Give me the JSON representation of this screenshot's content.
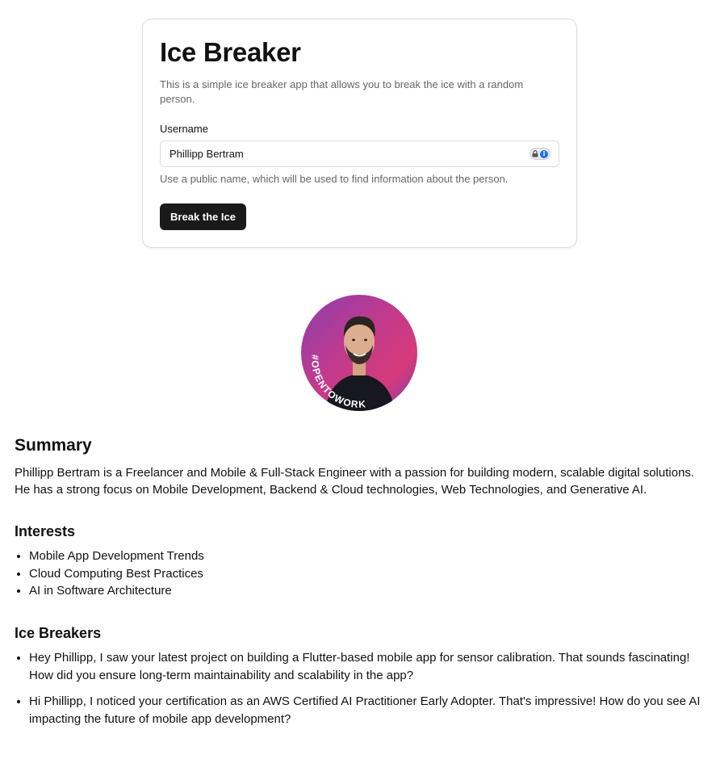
{
  "form": {
    "title": "Ice Breaker",
    "description": "This is a simple ice breaker app that allows you to break the ice with a random person.",
    "username_label": "Username",
    "username_value": "Phillipp Bertram",
    "help_text": "Use a public name, which will be used to find information about the person.",
    "submit_label": "Break the Ice",
    "password_manager_icon": "lock-info-icon"
  },
  "profile": {
    "avatar_badge": "#OPENTOWORK"
  },
  "summary": {
    "heading": "Summary",
    "text": "Phillipp Bertram is a Freelancer and Mobile & Full-Stack Engineer with a passion for building modern, scalable digital solutions. He has a strong focus on Mobile Development, Backend & Cloud technologies, Web Technologies, and Generative AI."
  },
  "interests": {
    "heading": "Interests",
    "items": [
      "Mobile App Development Trends",
      "Cloud Computing Best Practices",
      "AI in Software Architecture"
    ]
  },
  "ice_breakers": {
    "heading": "Ice Breakers",
    "items": [
      "Hey Phillipp, I saw your latest project on building a Flutter-based mobile app for sensor calibration. That sounds fascinating! How did you ensure long-term maintainability and scalability in the app?",
      "Hi Phillipp, I noticed your certification as an AWS Certified AI Practitioner Early Adopter. That's impressive! How do you see AI impacting the future of mobile app development?"
    ]
  },
  "colors": {
    "button_bg": "#1a1a1a",
    "muted_text": "#666666",
    "border": "#dcdcdc",
    "badge_green": "#3f6b3a"
  }
}
